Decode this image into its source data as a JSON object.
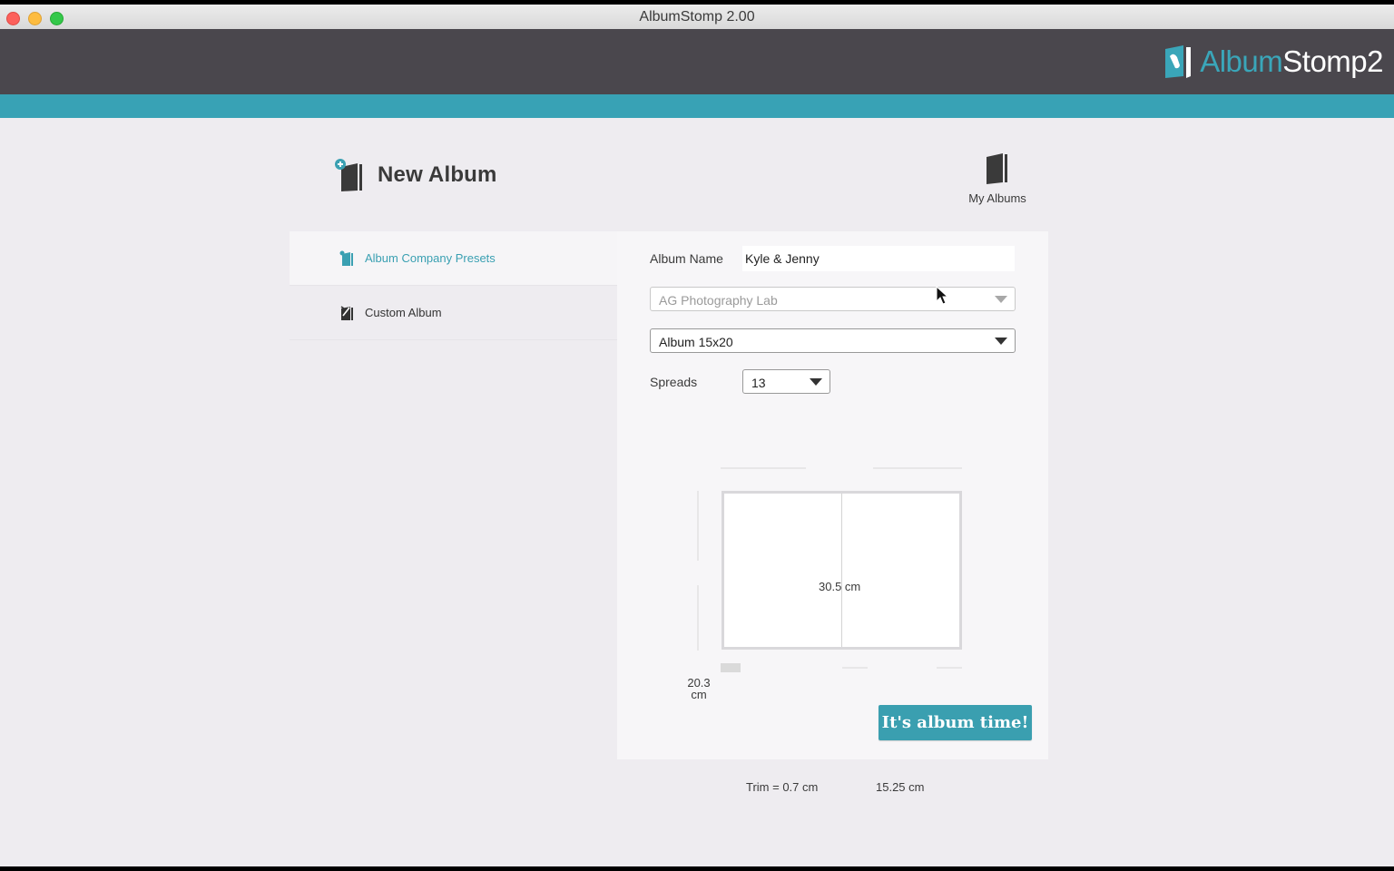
{
  "window": {
    "title": "AlbumStomp 2.00"
  },
  "brand": {
    "name_part1": "Album",
    "name_part2": "Stomp2",
    "accent": "#38a2b5",
    "header_bg": "#4a474d"
  },
  "page": {
    "title": "New Album",
    "my_albums_label": "My Albums"
  },
  "sidebar": {
    "items": [
      {
        "label": "Album Company Presets",
        "active": true,
        "icon": "preset-book-icon"
      },
      {
        "label": "Custom Album",
        "active": false,
        "icon": "custom-book-icon"
      }
    ]
  },
  "form": {
    "album_name_label": "Album Name",
    "album_name_value": "Kyle & Jenny",
    "company_select_value": "AG Photography Lab",
    "size_select_value": "Album 15x20",
    "spreads_label": "Spreads",
    "spreads_value": "13"
  },
  "diagram": {
    "width_label": "30.5 cm",
    "height_label_line1": "20.3",
    "height_label_line2": "cm",
    "trim_label": "Trim = 0.7 cm",
    "page_width_label": "15.25 cm"
  },
  "actions": {
    "submit_label": "It's album time!"
  }
}
